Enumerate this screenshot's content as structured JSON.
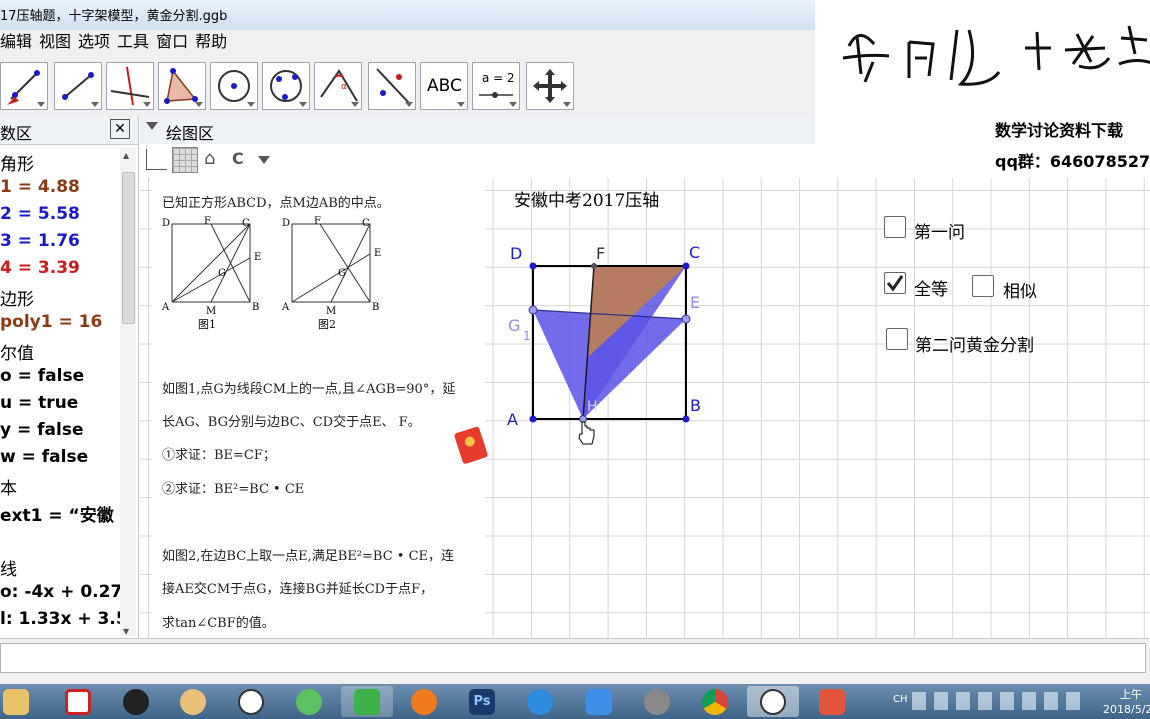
{
  "window": {
    "title": "17压轴题，十字架模型，黄金分割.ggb"
  },
  "menu": [
    "编辑",
    "视图",
    "选项",
    "工具",
    "窗口",
    "帮助"
  ],
  "toolbar": {
    "tools": [
      "move-point-icon",
      "point-icon",
      "line-icon",
      "perpendicular-icon",
      "polygon-icon",
      "circle-icon",
      "conic-icon",
      "angle-icon",
      "reflect-icon",
      "text-icon",
      "slider-icon",
      "move-view-icon"
    ],
    "text_tool_label": "ABC",
    "slider_tool_label": "a = 2"
  },
  "algebra": {
    "header": "数区",
    "lines": [
      {
        "text": "角形",
        "type": "category"
      },
      {
        "text": "1 = 4.88",
        "type": "value",
        "color": "#8b3a14"
      },
      {
        "text": "2 = 5.58",
        "type": "value",
        "color": "#1a1acc"
      },
      {
        "text": "3 = 1.76",
        "type": "value",
        "color": "#1a1acc"
      },
      {
        "text": "4 = 3.39",
        "type": "value",
        "color": "#cc1a1a"
      },
      {
        "text": "边形",
        "type": "category"
      },
      {
        "text": "poly1 = 16",
        "type": "value",
        "color": "#8b3a14"
      },
      {
        "text": "尔值",
        "type": "category"
      },
      {
        "text": "o = false",
        "type": "value",
        "color": "#000000"
      },
      {
        "text": "u = true",
        "type": "value",
        "color": "#000000"
      },
      {
        "text": "y = false",
        "type": "value",
        "color": "#000000"
      },
      {
        "text": "w = false",
        "type": "value",
        "color": "#000000"
      },
      {
        "text": "本",
        "type": "category"
      },
      {
        "text": "ext1 = “安徽",
        "type": "value",
        "color": "#000000"
      },
      {
        "text": "",
        "type": "category"
      },
      {
        "text": "线",
        "type": "category"
      },
      {
        "text": "o: -4x + 0.27y",
        "type": "value",
        "color": "#000000"
      },
      {
        "text": "l: 1.33x + 3.5",
        "type": "value",
        "color": "#000000"
      }
    ]
  },
  "graphics": {
    "header": "绘图区",
    "title_text": "安徽中考2017压轴",
    "points": {
      "D": "D",
      "F": "F",
      "C": "C",
      "E": "E",
      "G": "G",
      "G_sub": "1",
      "A": "A",
      "H": "H",
      "B": "B"
    },
    "fig_labels": {
      "fig1": "图1",
      "fig2": "图2",
      "D": "D",
      "F": "F",
      "C": "C",
      "E": "E",
      "G": "G",
      "A": "A",
      "M": "M",
      "B": "B"
    },
    "problem": {
      "intro": "已知正方形ABCD，点M边AB的中点。",
      "p1_line1": "如图1,点G为线段CM上的一点,且∠AGB=90°，延",
      "p1_line2": "长AG、BG分别与边BC、CD交于点E、  F。",
      "p1_q1": "①求证：BE=CF；",
      "p1_q2": "②求证：BE²=BC • CE",
      "p2_line1": "如图2,在边BC上取一点E,满足BE²=BC • CE，连",
      "p2_line2": "接AE交CM于点G，连接BG并延长CD于点F，",
      "p2_line3": "求tan∠CBF的值。"
    },
    "checkboxes": [
      {
        "label": "第一问",
        "checked": false
      },
      {
        "label": "全等",
        "checked": true
      },
      {
        "label": "相似",
        "checked": false
      },
      {
        "label": "第二问黄金分割",
        "checked": false
      }
    ]
  },
  "overlay": {
    "signature": "老司机+数学",
    "line1": "数学讨论资料下载",
    "line2": "qq群：646078527"
  },
  "taskbar": {
    "apps": [
      "explorer-icon",
      "screen-recorder-icon",
      "qq-icon",
      "paint-icon",
      "geogebra-icon",
      "wechat-icon",
      "camtasia-icon",
      "firefox-icon",
      "photoshop-icon",
      "baidu-cloud-icon",
      "feishu-icon",
      "tornado-icon",
      "chrome-icon",
      "geogebra-active-icon",
      "camtasia-red-icon"
    ],
    "tray_lang": "CH",
    "time": "上午",
    "date": "2018/5/2"
  },
  "colors": {
    "accent_blue": "#1a1acc",
    "brown": "#a0522d",
    "purple_fill": "#5b52e6",
    "orange_fill": "#b67c62"
  }
}
